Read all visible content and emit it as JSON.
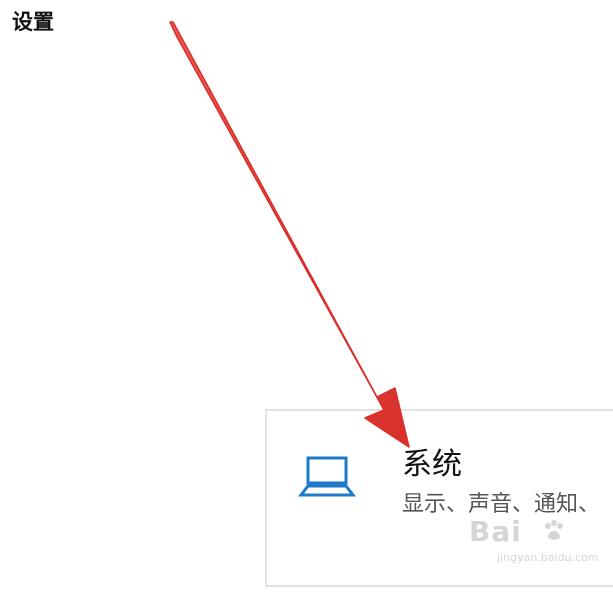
{
  "page": {
    "title": "设置"
  },
  "system_setting": {
    "title": "系统",
    "description": "显示、声音、通知、",
    "icon": "laptop-icon"
  },
  "annotation": {
    "icon": "red-arrow-icon",
    "color": "#e63a32"
  },
  "watermark": {
    "brand": "Bai",
    "secondary": "jingyan.baidu.com"
  },
  "colors": {
    "background": "#ffffff",
    "card_border": "#e3e3e3",
    "accent_blue": "#1f78c8",
    "text_primary": "#111111",
    "text_secondary": "#555555"
  }
}
